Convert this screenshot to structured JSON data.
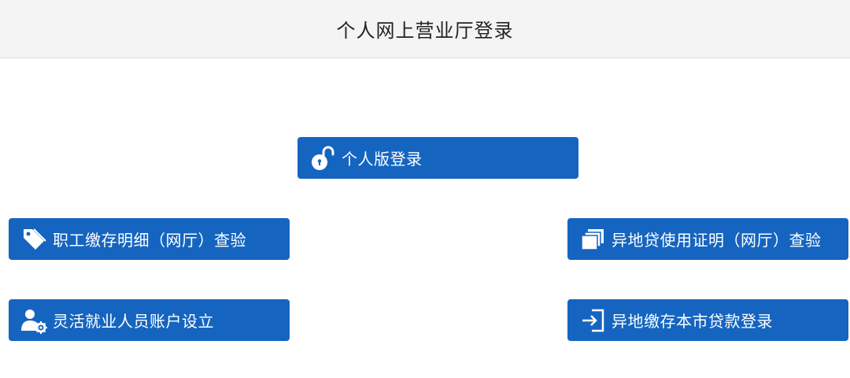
{
  "header": {
    "title": "个人网上营业厅登录"
  },
  "buttons": {
    "personal_login": {
      "label": "个人版登录",
      "icon": "unlock-icon"
    },
    "employee_detail": {
      "label": "职工缴存明细（网厅）查验",
      "icon": "tag-icon"
    },
    "remote_loan_cert": {
      "label": "异地贷使用证明（网厅）查验",
      "icon": "documents-icon"
    },
    "flexible_employment": {
      "label": "灵活就业人员账户设立",
      "icon": "user-settings-icon"
    },
    "remote_deposit_loan": {
      "label": "异地缴存本市贷款登录",
      "icon": "sign-in-icon"
    }
  },
  "colors": {
    "button_bg": "#1565c0",
    "header_bg": "#f4f4f4",
    "text_white": "#ffffff"
  }
}
